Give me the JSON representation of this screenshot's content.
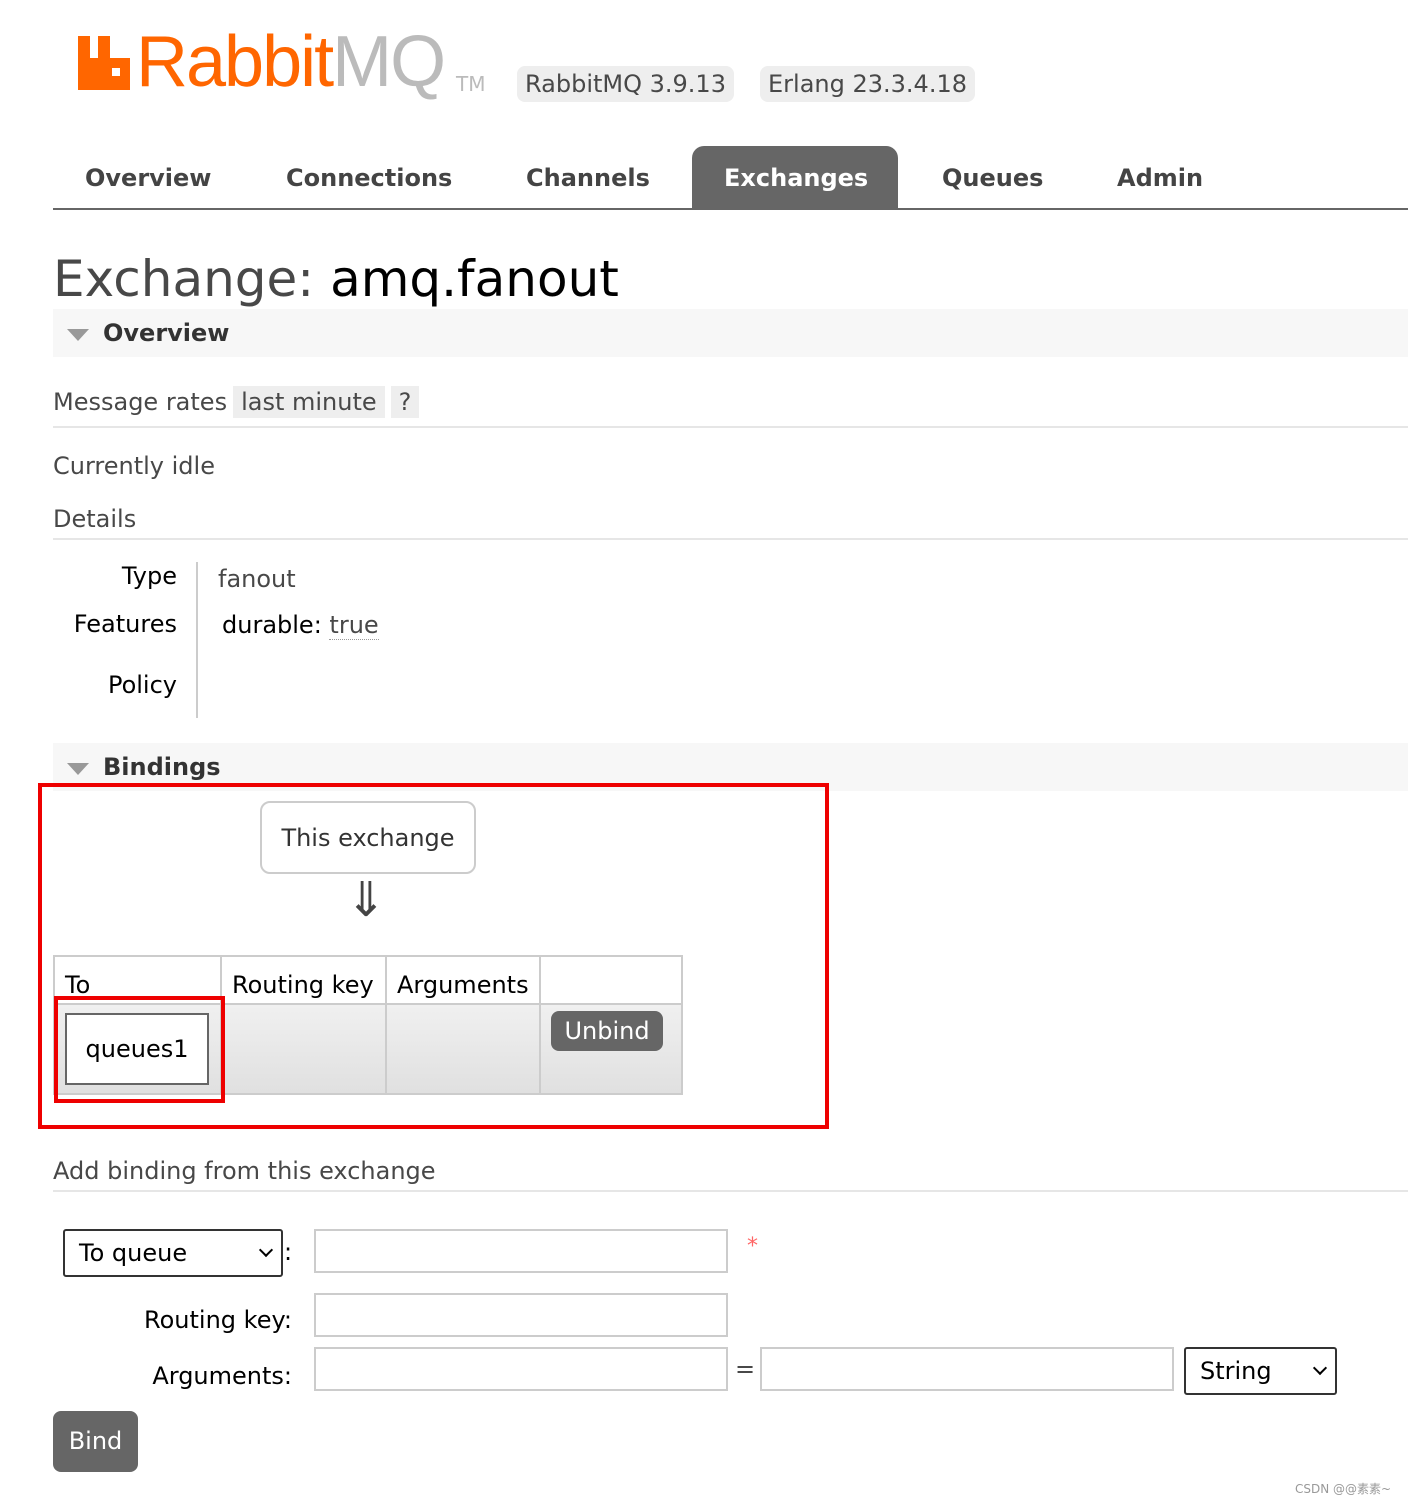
{
  "header": {
    "logo_text_orange": "Rabbit",
    "logo_text_grey": "MQ",
    "trademark": "TM",
    "version_badge": "RabbitMQ 3.9.13",
    "erlang_badge": "Erlang 23.3.4.18",
    "brand_color": "#ff6600"
  },
  "nav": {
    "tabs": [
      {
        "label": "Overview"
      },
      {
        "label": "Connections"
      },
      {
        "label": "Channels"
      },
      {
        "label": "Exchanges",
        "active": true
      },
      {
        "label": "Queues"
      },
      {
        "label": "Admin"
      }
    ]
  },
  "page": {
    "title_prefix": "Exchange:",
    "title_name": "amq.fanout"
  },
  "overview": {
    "heading": "Overview",
    "message_rates_label": "Message rates",
    "message_rates_range": "last minute",
    "help": "?",
    "status": "Currently idle",
    "details_heading": "Details",
    "details": {
      "type_label": "Type",
      "type_value": "fanout",
      "features_label": "Features",
      "features_key": "durable:",
      "features_value": "true",
      "policy_label": "Policy"
    }
  },
  "bindings": {
    "heading": "Bindings",
    "source_box": "This exchange",
    "arrow": "⇓",
    "columns": [
      "To",
      "Routing key",
      "Arguments",
      ""
    ],
    "rows": [
      {
        "to": "queues1",
        "routing_key": "",
        "arguments": "",
        "action": "Unbind"
      }
    ]
  },
  "add_binding": {
    "heading": "Add binding from this exchange",
    "destination_type": "To queue",
    "colon": ":",
    "required_mark": "*",
    "queue_value": "",
    "routing_key_label": "Routing key:",
    "routing_key_value": "",
    "arguments_label": "Arguments:",
    "arg_key_value": "",
    "equals": "=",
    "arg_value": "",
    "arg_type": "String",
    "bind_button": "Bind"
  },
  "watermark": "CSDN @@素素~"
}
